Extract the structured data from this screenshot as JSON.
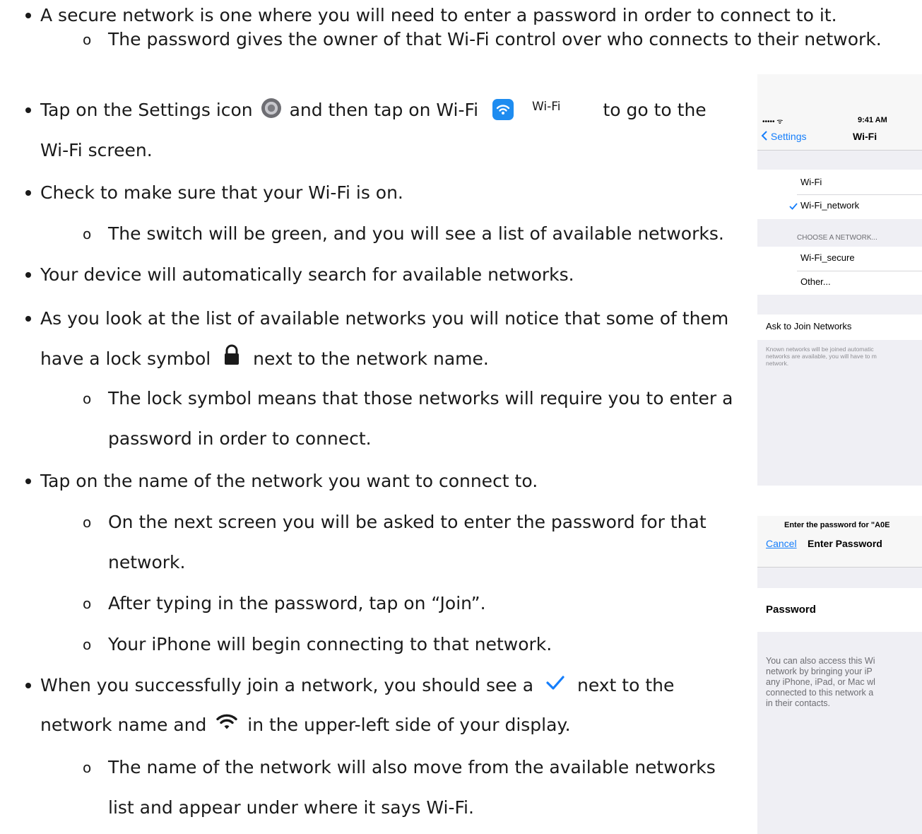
{
  "lines": {
    "l1": "A secure network is one where you will need to enter a password in order to connect to it.",
    "l2": "The password gives the owner of that Wi-Fi control over who connects to their network.",
    "l3a": "Tap on the Settings icon",
    "l3b": "and then tap on Wi-Fi",
    "l3c": "Wi-Fi",
    "l3d": "to go to the",
    "l4": "Wi-Fi screen.",
    "l5": "Check to make sure that your Wi-Fi is on.",
    "l6": "The switch will be green, and you will see a list of available networks.",
    "l7": "Your device will automatically search for available networks.",
    "l8": "As you look at the list of available networks you will notice that some of them",
    "l9a": "have a lock symbol",
    "l9b": "next to the network name.",
    "l10": "The lock symbol means that those networks will require you to enter a",
    "l11": "password in order to connect.",
    "l12": "Tap on the name of the network you want to connect to.",
    "l13": "On the next screen you will be asked to enter the password for that",
    "l14": "network.",
    "l15": "After typing in the password, tap on “Join”.",
    "l16": "Your iPhone will begin connecting to that network.",
    "l17a": "When you successfully join a network, you should see a",
    "l17b": "next to the",
    "l18a": "network name and",
    "l18b": "in the upper-left side of your display.",
    "l19": "The name of the network will also move from the available networks",
    "l20": "list and appear under where it says Wi-Fi."
  },
  "subbullet_glyph": "o",
  "phone1": {
    "signal": "••••• ᯤ",
    "time": "9:41 AM",
    "back": "Settings",
    "title": "Wi-Fi",
    "wifi_row": "Wi-Fi",
    "connected": "Wi-Fi_network",
    "section": "CHOOSE A NETWORK...",
    "net1": "Wi-Fi_secure",
    "other": "Other...",
    "ask": "Ask to Join Networks",
    "note1": "Known networks will be joined automatic",
    "note2": "networks are available, you will have to m",
    "note3": "network."
  },
  "phone2": {
    "prompt": "Enter the password for \"A0E",
    "cancel": "Cancel",
    "title": "Enter Password",
    "label": "Password",
    "info1": "You can also access this Wi",
    "info2": "network by bringing your iP",
    "info3": "any iPhone, iPad, or Mac wl",
    "info4": "connected to this network a",
    "info5": "in their contacts."
  },
  "colors": {
    "accent": "#1e8cf0",
    "ios_blue": "#157efb",
    "text": "#1a1a1a"
  }
}
